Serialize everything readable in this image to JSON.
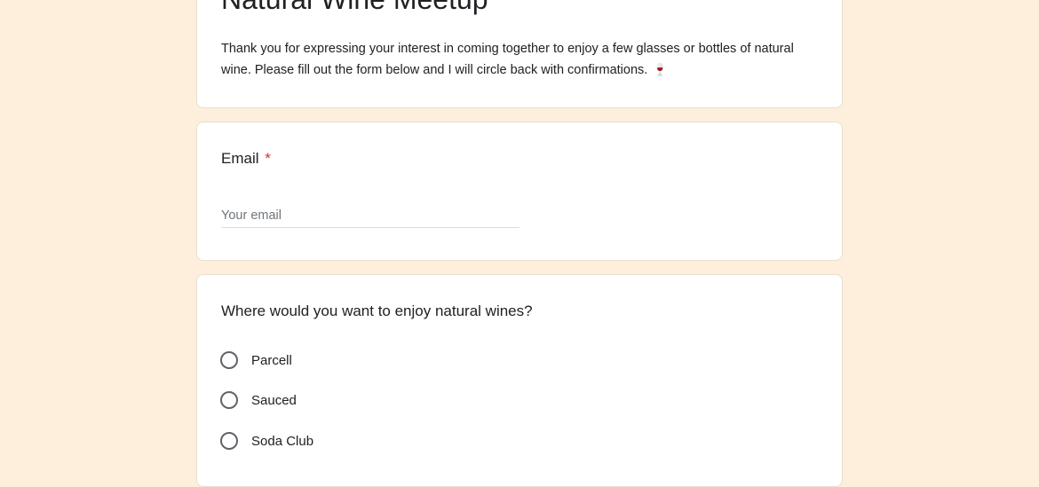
{
  "header": {
    "title": "Natural Wine Meetup",
    "description": "Thank you for expressing your interest in coming together to enjoy a few glasses or bottles of natural wine. Please fill out the form below and I will circle back with confirmations.",
    "emoji": "🍷"
  },
  "email": {
    "label": "Email",
    "required_mark": "*",
    "placeholder": "Your email",
    "value": ""
  },
  "where": {
    "question": "Where would you want to enjoy natural wines?",
    "options": [
      {
        "label": "Parcell"
      },
      {
        "label": "Sauced"
      },
      {
        "label": "Soda Club"
      }
    ]
  }
}
